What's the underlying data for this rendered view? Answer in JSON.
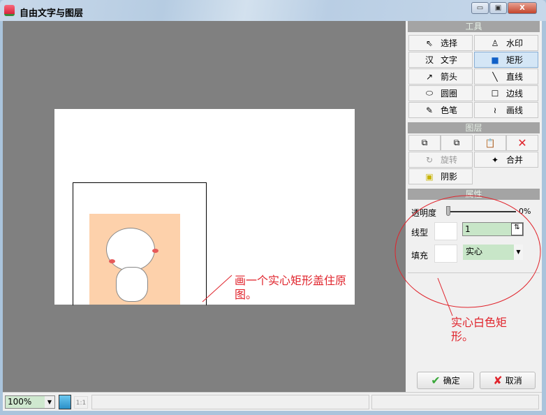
{
  "window": {
    "title": "自由文字与图层",
    "minimize": "▭",
    "maximize": "▣",
    "close": "X"
  },
  "tools": {
    "header": "工具",
    "items": [
      {
        "label": "选择",
        "icon": "cursor-icon",
        "glyph": "⇖"
      },
      {
        "label": "水印",
        "icon": "stamp-icon",
        "glyph": "♙"
      },
      {
        "label": "文字",
        "icon": "text-icon",
        "glyph": "汉"
      },
      {
        "label": "矩形",
        "icon": "rectangle-icon",
        "glyph": "■",
        "selected": true
      },
      {
        "label": "箭头",
        "icon": "arrow-icon",
        "glyph": "↗"
      },
      {
        "label": "直线",
        "icon": "line-icon",
        "glyph": "╲"
      },
      {
        "label": "圆圈",
        "icon": "ellipse-icon",
        "glyph": "⬭"
      },
      {
        "label": "边线",
        "icon": "border-icon",
        "glyph": "☐"
      },
      {
        "label": "色笔",
        "icon": "highlighter-icon",
        "glyph": "✎"
      },
      {
        "label": "画线",
        "icon": "freehand-icon",
        "glyph": "≀"
      }
    ]
  },
  "layers": {
    "header": "图层",
    "rotate": "旋转",
    "merge": "合并",
    "shadow": "阴影",
    "delete_glyph": "✕"
  },
  "properties": {
    "header": "属性",
    "opacity_label": "透明度",
    "opacity_value": "0%",
    "opacity": 0,
    "line_label": "线型",
    "line_value": "1",
    "fill_label": "填充",
    "fill_value": "实心"
  },
  "annotations": {
    "canvas_note": "画一个实心矩形盖住原图。",
    "panel_note": "实心白色矩形。"
  },
  "actions": {
    "ok": "确定",
    "cancel": "取消"
  },
  "status": {
    "zoom": "100%",
    "one_to_one": "1:1"
  },
  "colors": {
    "annotation": "#e0242c",
    "selected": "#d4e6f6"
  }
}
